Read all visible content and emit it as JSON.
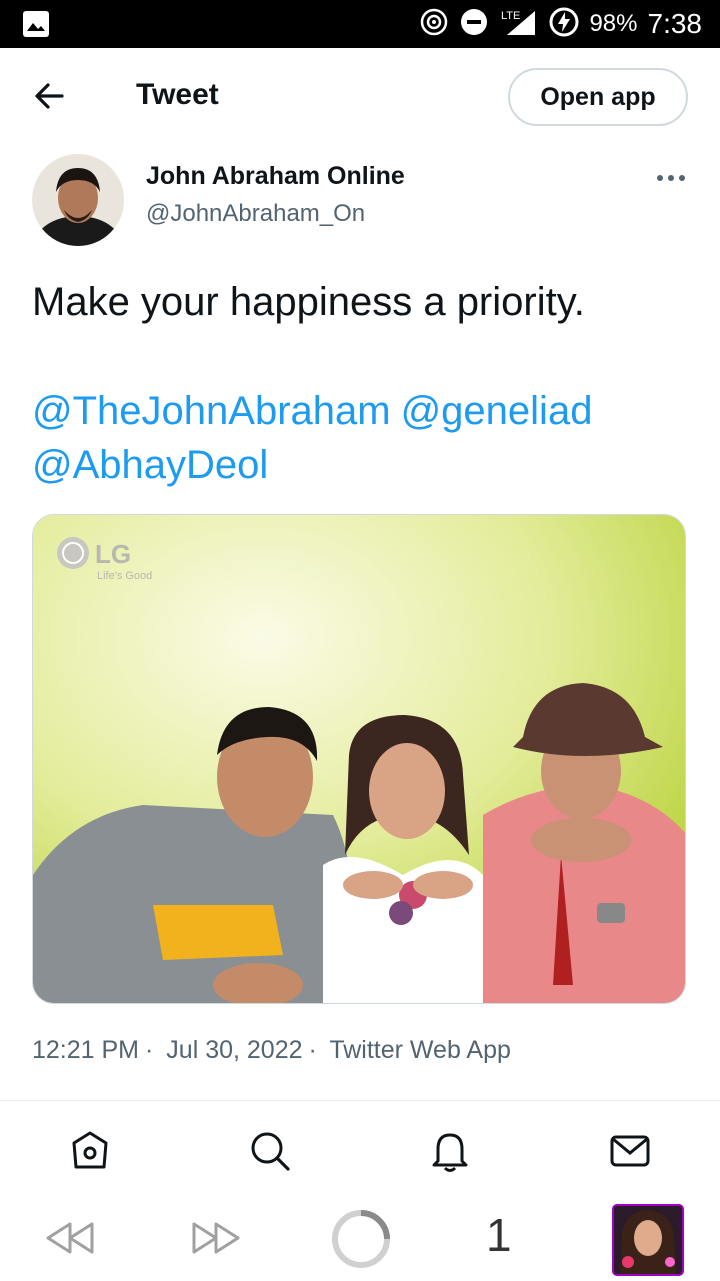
{
  "status_bar": {
    "battery": "98%",
    "time": "7:38",
    "network": "LTE"
  },
  "header": {
    "title": "Tweet",
    "open_app": "Open app"
  },
  "tweet": {
    "author_name": "John Abraham Online",
    "author_handle": "@JohnAbraham_On",
    "text": "Make your happiness a priority.",
    "mentions": [
      "@TheJohnAbraham",
      "@geneliad",
      "@AbhayDeol"
    ],
    "photo": {
      "logo": "LG",
      "tagline": "Life's Good"
    },
    "time": "12:21 PM",
    "date": "Jul 30, 2022",
    "source": "Twitter Web App",
    "separator": "·"
  },
  "tabs": [
    "home-icon",
    "search-icon",
    "notifications-icon",
    "messages-icon"
  ],
  "browser": {
    "tab_count": "1"
  },
  "colors": {
    "accent": "#1d9bf0",
    "secondary_text": "#536471"
  }
}
